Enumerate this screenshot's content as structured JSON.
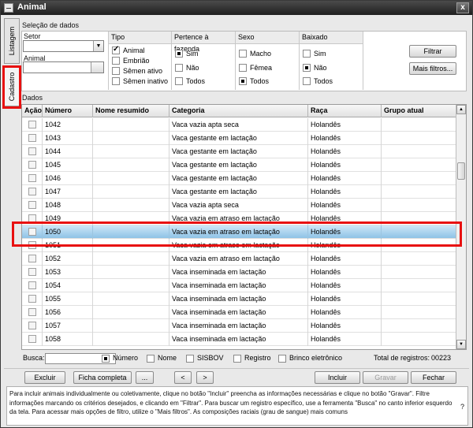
{
  "window": {
    "title": "Animal",
    "close_label": "x"
  },
  "tabs": {
    "listagem": "Listagem",
    "cadastro": "Cadastro"
  },
  "selection": {
    "section_label": "Seleção de dados",
    "setor_label": "Setor",
    "setor_value": "",
    "animal_label": "Animal",
    "animal_value": ""
  },
  "filters": {
    "tipo": {
      "header": "Tipo",
      "options": [
        {
          "label": "Animal",
          "state": "checked"
        },
        {
          "label": "Embrião",
          "state": "off"
        },
        {
          "label": "Sêmen ativo",
          "state": "off"
        },
        {
          "label": "Sêmen inativo",
          "state": "off"
        }
      ]
    },
    "pertence": {
      "header": "Pertence à fazenda",
      "options": [
        {
          "label": "Sim",
          "state": "selected"
        },
        {
          "label": "Não",
          "state": "off"
        },
        {
          "label": "Todos",
          "state": "off"
        }
      ]
    },
    "sexo": {
      "header": "Sexo",
      "options": [
        {
          "label": "Macho",
          "state": "off"
        },
        {
          "label": "Fêmea",
          "state": "off"
        },
        {
          "label": "Todos",
          "state": "selected"
        }
      ]
    },
    "baixado": {
      "header": "Baixado",
      "options": [
        {
          "label": "Sim",
          "state": "off"
        },
        {
          "label": "Não",
          "state": "selected"
        },
        {
          "label": "Todos",
          "state": "off"
        }
      ]
    }
  },
  "buttons": {
    "filtrar": "Filtrar",
    "mais_filtros": "Mais filtros..."
  },
  "data_section_label": "Dados",
  "grid": {
    "columns": [
      "Ação",
      "Número",
      "Nome resumido",
      "Categoria",
      "Raça",
      "Grupo atual"
    ],
    "rows": [
      {
        "numero": "1042",
        "nome": "",
        "categoria": "Vaca vazia apta seca",
        "raca": "Holandês",
        "grupo": ""
      },
      {
        "numero": "1043",
        "nome": "",
        "categoria": "Vaca gestante em lactação",
        "raca": "Holandês",
        "grupo": ""
      },
      {
        "numero": "1044",
        "nome": "",
        "categoria": "Vaca gestante em lactação",
        "raca": "Holandês",
        "grupo": ""
      },
      {
        "numero": "1045",
        "nome": "",
        "categoria": "Vaca gestante em lactação",
        "raca": "Holandês",
        "grupo": ""
      },
      {
        "numero": "1046",
        "nome": "",
        "categoria": "Vaca gestante em lactação",
        "raca": "Holandês",
        "grupo": ""
      },
      {
        "numero": "1047",
        "nome": "",
        "categoria": "Vaca gestante em lactação",
        "raca": "Holandês",
        "grupo": ""
      },
      {
        "numero": "1048",
        "nome": "",
        "categoria": "Vaca vazia apta seca",
        "raca": "Holandês",
        "grupo": ""
      },
      {
        "numero": "1049",
        "nome": "",
        "categoria": "Vaca vazia em atraso em lactação",
        "raca": "Holandês",
        "grupo": ""
      },
      {
        "numero": "1050",
        "nome": "",
        "categoria": "Vaca vazia em atraso em lactação",
        "raca": "Holandês",
        "grupo": "",
        "selected": true
      },
      {
        "numero": "1051",
        "nome": "",
        "categoria": "Vaca vazia em atraso em lactação",
        "raca": "Holandês",
        "grupo": ""
      },
      {
        "numero": "1052",
        "nome": "",
        "categoria": "Vaca vazia em atraso em lactação",
        "raca": "Holandês",
        "grupo": ""
      },
      {
        "numero": "1053",
        "nome": "",
        "categoria": "Vaca inseminada em lactação",
        "raca": "Holandês",
        "grupo": ""
      },
      {
        "numero": "1054",
        "nome": "",
        "categoria": "Vaca inseminada em lactação",
        "raca": "Holandês",
        "grupo": ""
      },
      {
        "numero": "1055",
        "nome": "",
        "categoria": "Vaca inseminada em lactação",
        "raca": "Holandês",
        "grupo": ""
      },
      {
        "numero": "1056",
        "nome": "",
        "categoria": "Vaca inseminada em lactação",
        "raca": "Holandês",
        "grupo": ""
      },
      {
        "numero": "1057",
        "nome": "",
        "categoria": "Vaca inseminada em lactação",
        "raca": "Holandês",
        "grupo": ""
      },
      {
        "numero": "1058",
        "nome": "",
        "categoria": "Vaca inseminada em lactação",
        "raca": "Holandês",
        "grupo": ""
      }
    ]
  },
  "search": {
    "label": "Busca:",
    "value": "",
    "options": [
      {
        "label": "Número",
        "state": "selected"
      },
      {
        "label": "Nome",
        "state": "off"
      },
      {
        "label": "SISBOV",
        "state": "off"
      },
      {
        "label": "Registro",
        "state": "off"
      },
      {
        "label": "Brinco eletrônico",
        "state": "off"
      }
    ],
    "total_label": "Total de registros:",
    "total_value": "00223"
  },
  "actions": {
    "excluir": "Excluir",
    "ficha": "Ficha completa",
    "more": "...",
    "prev": "<",
    "next": ">",
    "incluir": "Incluir",
    "gravar": "Gravar",
    "fechar": "Fechar"
  },
  "help_text": "Para incluir animais individualmente ou coletivamente, clique no botão \"Incluir\" preencha as informações necessárias e clique no botão \"Gravar\". Filtre informações marcando os critérios desejados, e clicando em \"Filtrar\". Para buscar um registro específico, use a ferramenta \"Busca\" no canto inferior esquerdo da tela. Para acessar mais opções de filtro, utilize o \"Mais filtros\". As composições raciais (grau de sangue) mais comuns",
  "help_icon_label": "?"
}
